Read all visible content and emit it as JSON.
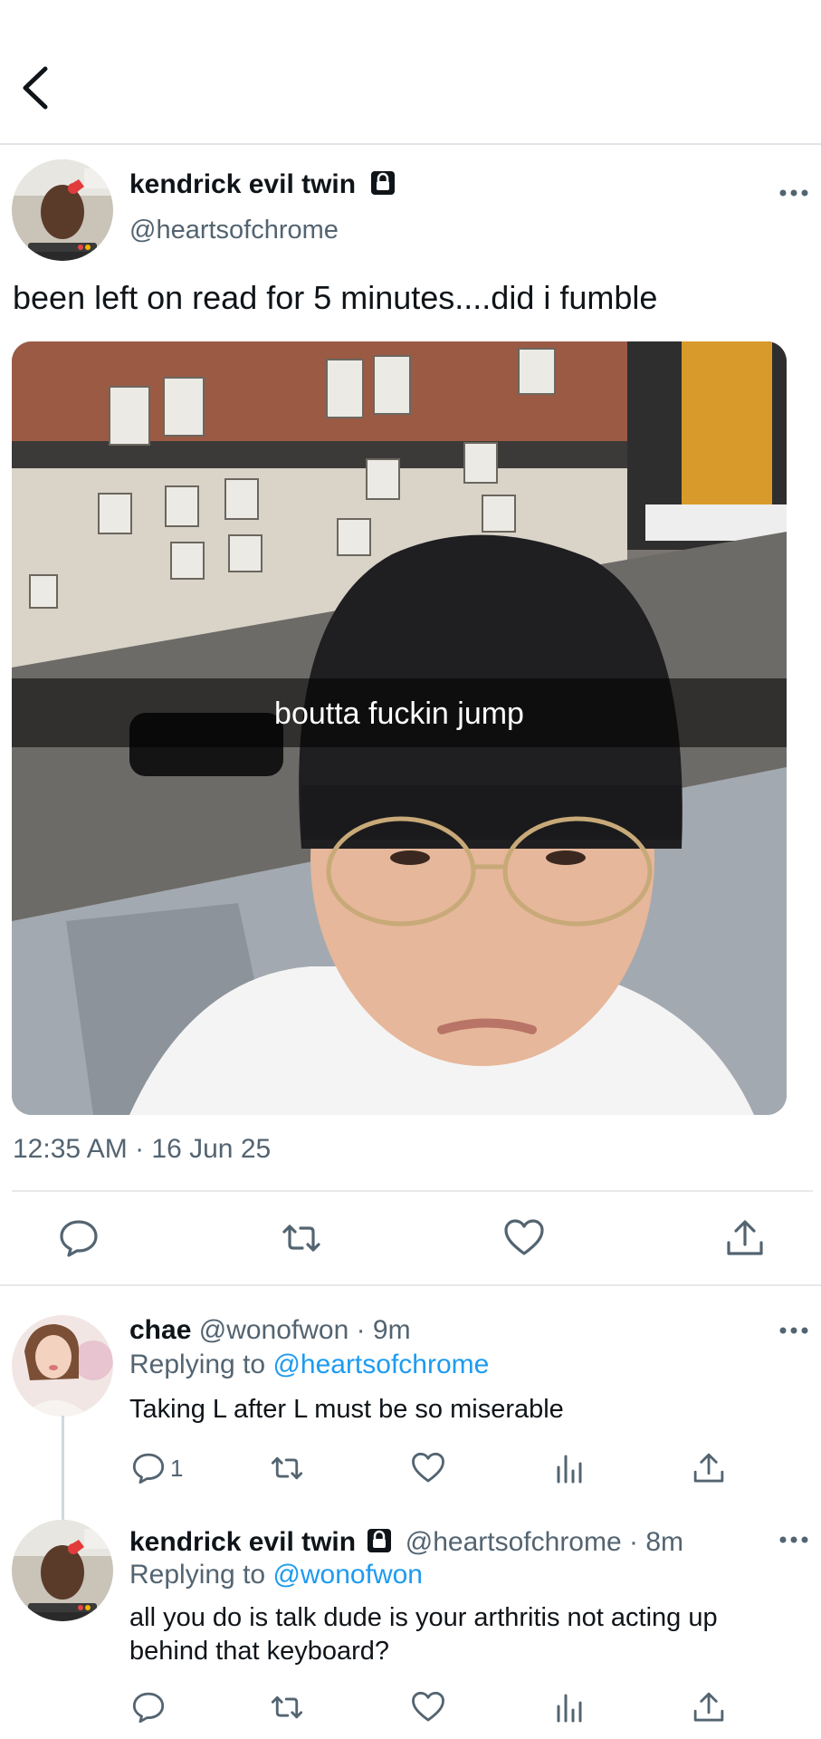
{
  "header": {
    "back_icon": "chevron-left-icon"
  },
  "tweet": {
    "display_name": "kendrick evil twin",
    "handle": "@heartsofchrome",
    "text": "been left on read for 5 minutes....did i fumble",
    "media_caption": "boutta fuckin jump",
    "timestamp": "12:35 AM · 16 Jun 25"
  },
  "replies": [
    {
      "display_name": "chae",
      "handle_time": "@wonofwon · 9m",
      "replying_prefix": "Replying to",
      "replying_to": "@heartsofchrome",
      "text": "Taking L after L must be so miserable",
      "reply_count": "1"
    },
    {
      "display_name": "kendrick evil twin",
      "handle_time": "@heartsofchrome · 8m",
      "replying_prefix": "Replying to",
      "replying_to": "@wonofwon",
      "text_line1": "all you do is talk dude is your arthritis not acting up",
      "text_line2": "behind that keyboard?"
    }
  ],
  "colors": {
    "link": "#1d9bf0",
    "secondary": "#536471",
    "primary": "#0f1419"
  }
}
